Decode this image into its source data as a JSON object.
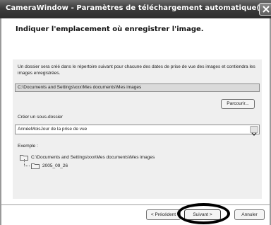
{
  "window": {
    "title": "CameraWindow - Paramètres de téléchargement automatique(2)"
  },
  "page": {
    "heading": "Indiquer l'emplacement où enregistrer l'image.",
    "description": "Un dossier sera créé dans le répertoire suivant pour chacune des dates de prise de vue des images et contiendra les images enregistrées.",
    "path_value": "C:\\Documents and Settings\\xxx\\Mes documents\\Mes images",
    "browse_label": "Parcourir...",
    "subfolder_label": "Créer un sous-dossier",
    "subfolder_selected": "AnnéeMoisJour de la prise de vue",
    "example_label": "Exemple :",
    "example_tree": {
      "root": "C:\\Documents and Settings\\xxx\\Mes documents\\Mes images",
      "child": "2005_09_26"
    }
  },
  "footer": {
    "prev_label": "< Précédent",
    "next_label": "Suivant >",
    "cancel_label": "Annuler"
  },
  "icons": [
    "close-icon",
    "folder-icon",
    "chevron-down-icon"
  ]
}
